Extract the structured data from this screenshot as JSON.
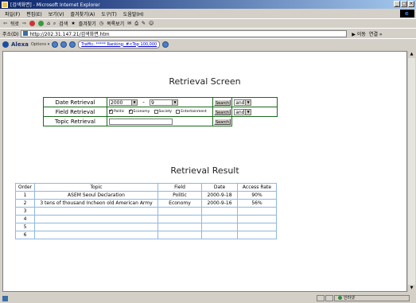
{
  "window": {
    "title": "[검색화면] - Microsoft Internet Explorer"
  },
  "menu": [
    "파일(F)",
    "편집(E)",
    "보기(V)",
    "즐겨찾기(A)",
    "도구(T)",
    "도움말(H)"
  ],
  "toolbar": {
    "back": "뒤로",
    "search": "검색",
    "favorites": "즐겨찾기",
    "history": "목록보기"
  },
  "address": {
    "label": "주소(D)",
    "url": "http://202.31.147.21/검색화면.htm",
    "go": "이동",
    "links": "연결 »"
  },
  "alexa": {
    "name": "Alexa",
    "options": "Options ▾",
    "traffic": "Traffic: ***** Ranking: #<Top 100,000"
  },
  "page": {
    "heading": "Retrieval Screen",
    "form": {
      "date": {
        "label": "Date Retrieval",
        "from": "2000",
        "dash": "-",
        "to": "9",
        "button": "Search",
        "op": "and"
      },
      "field": {
        "label": "Field Retrieval",
        "options": [
          "Politic",
          "Economy",
          "Society",
          "Entertainment"
        ],
        "checked": [
          true,
          true,
          false,
          false
        ],
        "button": "Search",
        "op": "and"
      },
      "topic": {
        "label": "Topic Retrieval",
        "value": "",
        "button": "Search"
      }
    },
    "result_heading": "Retrieval Result",
    "results": {
      "headers": [
        "Order",
        "Topic",
        "Field",
        "Date",
        "Access Rate"
      ],
      "rows": [
        [
          "1",
          "ASEM Seoul Declaration",
          "Politic",
          "2000-9-18",
          "90%"
        ],
        [
          "2",
          "3 tens of thousand Incheon old American Army",
          "Economy",
          "2000-9-16",
          "56%"
        ],
        [
          "3",
          "",
          "",
          "",
          ""
        ],
        [
          "4",
          "",
          "",
          "",
          ""
        ],
        [
          "5",
          "",
          "",
          "",
          ""
        ],
        [
          "6",
          "",
          "",
          "",
          ""
        ]
      ]
    }
  },
  "status": {
    "zone": "인터넷"
  }
}
